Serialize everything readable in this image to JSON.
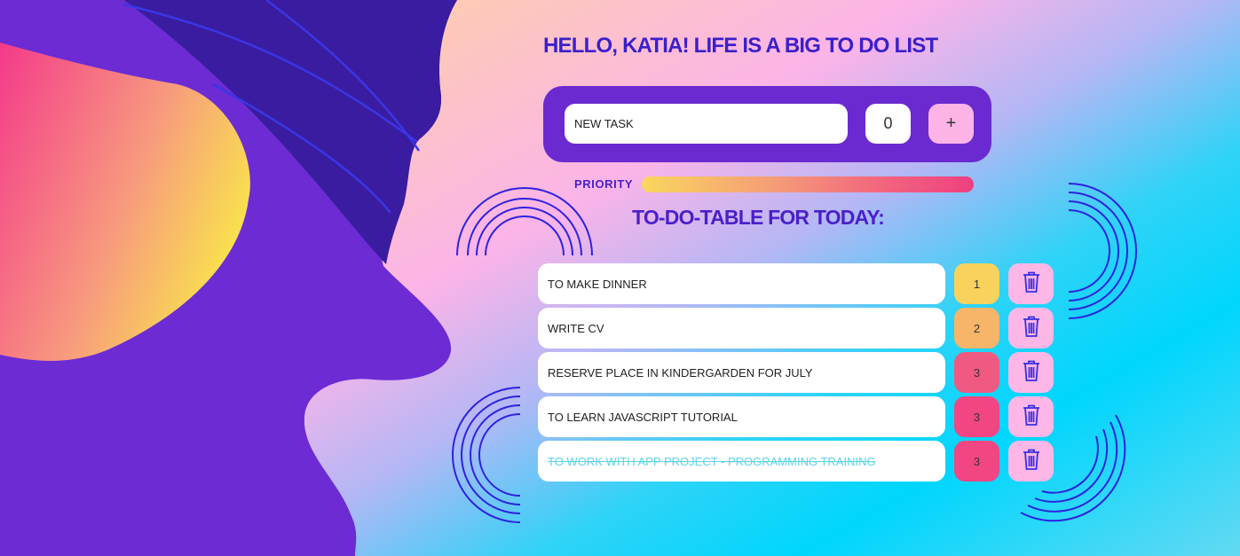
{
  "header": {
    "title": "HELLO, KATIA! LIFE IS A BIG TO DO LIST"
  },
  "new_task": {
    "placeholder": "NEW TASK",
    "priority_value": "0",
    "add_label": "+"
  },
  "priority": {
    "label": "PRIORITY"
  },
  "table": {
    "title": "TO-DO-TABLE FOR TODAY:",
    "tasks": [
      {
        "text": "TO MAKE DINNER",
        "priority": "1",
        "color": "#f8d25c",
        "done": false
      },
      {
        "text": "WRITE CV",
        "priority": "2",
        "color": "#f7b56a",
        "done": false
      },
      {
        "text": "RESERVE PLACE IN KINDERGARDEN FOR JULY",
        "priority": "3",
        "color": "#f05a80",
        "done": false
      },
      {
        "text": "TO LEARN JAVASCRIPT TUTORIAL",
        "priority": "3",
        "color": "#f24583",
        "done": false
      },
      {
        "text": "TO WORK WITH APP PROJECT - PROGRAMMING TRAINING",
        "priority": "3",
        "color": "#f24583",
        "done": true
      }
    ]
  },
  "icons": {
    "delete": "trash-icon"
  },
  "colors": {
    "accent": "#3b1fcb",
    "panel": "#6a2ad0",
    "button": "#fcb3e6"
  }
}
